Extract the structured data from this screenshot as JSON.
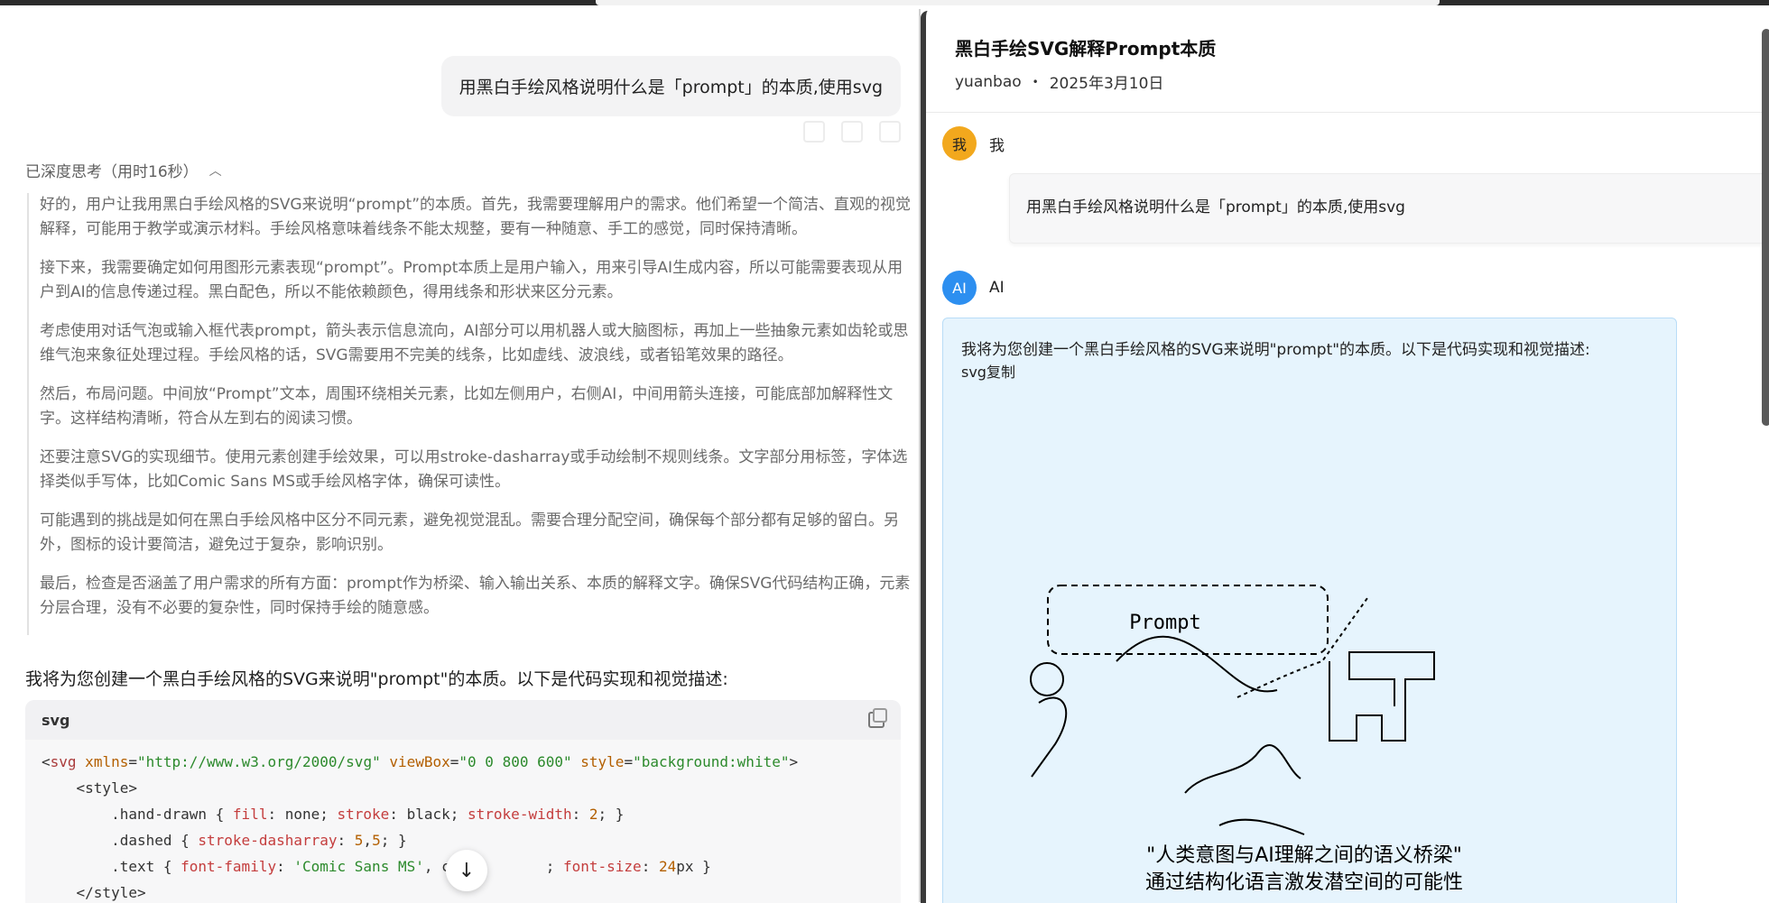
{
  "left": {
    "user_message": "用黑白手绘风格说明什么是「prompt」的本质,使用svg",
    "thinking_header": "已深度思考（用时16秒）",
    "thinking_paragraphs": [
      "好的，用户让我用黑白手绘风格的SVG来说明“prompt”的本质。首先，我需要理解用户的需求。他们希望一个简洁、直观的视觉解释，可能用于教学或演示材料。手绘风格意味着线条不能太规整，要有一种随意、手工的感觉，同时保持清晰。",
      "接下来，我需要确定如何用图形元素表现“prompt”。Prompt本质上是用户输入，用来引导AI生成内容，所以可能需要表现从用户到AI的信息传递过程。黑白配色，所以不能依赖颜色，得用线条和形状来区分元素。",
      "考虑使用对话气泡或输入框代表prompt，箭头表示信息流向，AI部分可以用机器人或大脑图标，再加上一些抽象元素如齿轮或思维气泡来象征处理过程。手绘风格的话，SVG需要用不完美的线条，比如虚线、波浪线，或者铅笔效果的路径。",
      "然后，布局问题。中间放“Prompt”文本，周围环绕相关元素，比如左侧用户，右侧AI，中间用箭头连接，可能底部加解释性文字。这样结构清晰，符合从左到右的阅读习惯。",
      "还要注意SVG的实现细节。使用元素创建手绘效果，可以用stroke-dasharray或手动绘制不规则线条。文字部分用标签，字体选择类似手写体，比如Comic Sans MS或手绘风格字体，确保可读性。",
      "可能遇到的挑战是如何在黑白手绘风格中区分不同元素，避免视觉混乱。需要合理分配空间，确保每个部分都有足够的留白。另外，图标的设计要简洁，避免过于复杂，影响识别。",
      "最后，检查是否涵盖了用户需求的所有方面：prompt作为桥梁、输入输出关系、本质的解释文字。确保SVG代码结构正确，元素分层合理，没有不必要的复杂性，同时保持手绘的随意感。"
    ],
    "answer_intro": "我将为您创建一个黑白手绘风格的SVG来说明\"prompt\"的本质。以下是代码实现和视觉描述:",
    "code_lang": "svg",
    "code": {
      "l1_open": "<",
      "l1_tag": "svg",
      "l1_a1": " xmlns",
      "l1_eq1": "=",
      "l1_v1": "\"http://www.w3.org/2000/svg\"",
      "l1_a2": " viewBox",
      "l1_eq2": "=",
      "l1_v2": "\"0 0 800 600\"",
      "l1_a3": " style",
      "l1_eq3": "=",
      "l1_v3": "\"background:white\"",
      "l1_close": ">",
      "l2": "    <style>",
      "l3_sel": "        .hand-drawn { ",
      "l3_p1": "fill",
      "l3_t1": ": none; ",
      "l3_p2": "stroke",
      "l3_t2": ": black; ",
      "l3_p3": "stroke-width",
      "l3_t3": ": ",
      "l3_n": "2",
      "l3_end": "; }",
      "l4_sel": "        .dashed { ",
      "l4_p": "stroke-dasharray",
      "l4_t": ": ",
      "l4_n1": "5",
      "l4_c": ",",
      "l4_n2": "5",
      "l4_end": "; }",
      "l5_sel": "        .text { ",
      "l5_p1": "font-family",
      "l5_t1": ": ",
      "l5_s": "'Comic Sans MS'",
      "l5_t2": ", cu",
      "l5_gap": "          ",
      "l5_t3": "; ",
      "l5_p2": "font-size",
      "l5_t4": ": ",
      "l5_n": "24",
      "l5_end": "px }",
      "l6": "    </style>"
    }
  },
  "right": {
    "title": "黑白手绘SVG解释Prompt本质",
    "author": "yuanbao",
    "dot": "•",
    "date": "2025年3月10日",
    "me_avatar": "我",
    "me_name": "我",
    "quoted_message": "用黑白手绘风格说明什么是「prompt」的本质,使用svg",
    "ai_avatar": "AI",
    "ai_name": "AI",
    "ai_intro": "我将为您创建一个黑白手绘风格的SVG来说明\"prompt\"的本质。以下是代码实现和视觉描述:",
    "ai_code_label": "svg复制",
    "svg_prompt_label": "Prompt",
    "svg_caption_1": "\"人类意图与AI理解之间的语义桥梁\"",
    "svg_caption_2": "通过结构化语言激发潜空间的可能性"
  },
  "icons": {
    "chevron": "chevron-up-icon",
    "copy": "copy-icon",
    "scroll_down": "arrow-down-icon"
  },
  "colors": {
    "ai_card_bg": "#e6f4fd",
    "me_avatar": "#f2a81d",
    "ai_avatar": "#2d8ff0"
  }
}
